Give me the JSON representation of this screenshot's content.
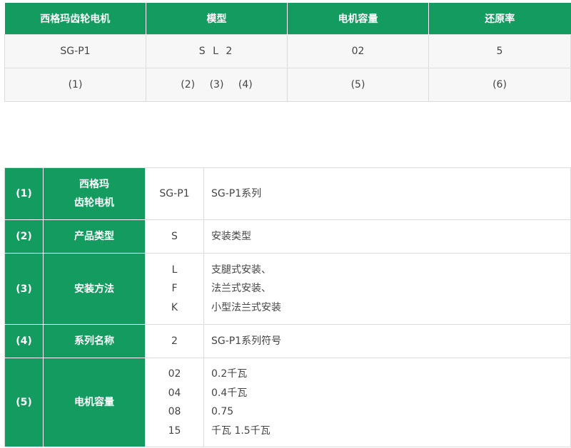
{
  "top_table": {
    "headers": [
      "西格玛齿轮电机",
      "模型",
      "电机容量",
      "还原率"
    ],
    "values_row": [
      "SG-P1",
      "S L 2",
      "02",
      "5"
    ],
    "refs_row": {
      "col1": "(1)",
      "col2": [
        "(2)",
        "(3)",
        "(4)"
      ],
      "col3": "(5)",
      "col4": "(6)"
    }
  },
  "detail_table": {
    "rows": [
      {
        "num": "(1)",
        "name_lines": [
          "西格玛",
          "齿轮电机"
        ],
        "codes": [
          "SG-P1"
        ],
        "descs": [
          "SG-P1系列"
        ]
      },
      {
        "num": "(2)",
        "name_lines": [
          "产品类型"
        ],
        "codes": [
          "S"
        ],
        "descs": [
          "安装类型"
        ]
      },
      {
        "num": "(3)",
        "name_lines": [
          "安装方法"
        ],
        "codes": [
          "L",
          "F",
          "K"
        ],
        "descs": [
          "支腿式安装、",
          "法兰式安装、",
          "小型法兰式安装"
        ]
      },
      {
        "num": "(4)",
        "name_lines": [
          "系列名称"
        ],
        "codes": [
          "2"
        ],
        "descs": [
          "SG-P1系列符号"
        ]
      },
      {
        "num": "(5)",
        "name_lines": [
          "电机容量"
        ],
        "codes": [
          "02",
          "04",
          "08",
          "15"
        ],
        "descs": [
          "0.2千瓦",
          "0.4千瓦",
          "0.75",
          "千瓦 1.5千瓦"
        ]
      }
    ]
  },
  "colors": {
    "header_green": "#149b5f",
    "cell_bg": "#f7f7f7",
    "border": "#dcdcdc"
  }
}
